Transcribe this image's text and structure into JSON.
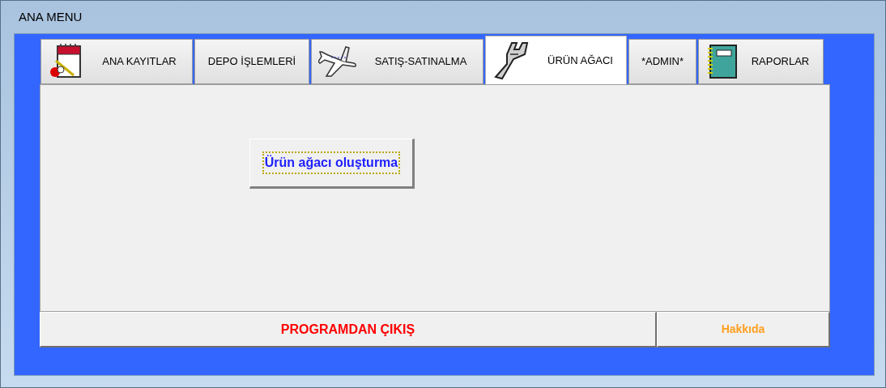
{
  "window": {
    "title": "ANA MENU"
  },
  "tabs": [
    {
      "label": "ANA KAYITLAR",
      "kind": "notepad",
      "selected": false
    },
    {
      "label": "DEPO İŞLEMLERİ",
      "kind": "text",
      "selected": false
    },
    {
      "label": "SATIŞ-SATINALMA",
      "kind": "plane",
      "selected": false
    },
    {
      "label": "ÜRÜN AĞACI",
      "kind": "wrench",
      "selected": true
    },
    {
      "label": "*ADMIN*",
      "kind": "text",
      "selected": false
    },
    {
      "label": "RAPORLAR",
      "kind": "notebook",
      "selected": false
    }
  ],
  "content_buttons": [
    {
      "label": "Ürün ağacı oluşturma",
      "focused": true
    }
  ],
  "bottom_buttons": [
    {
      "label": "PROGRAMDAN ÇIKIŞ",
      "kind": "exit"
    },
    {
      "label": "Hakkıda",
      "kind": "about"
    }
  ]
}
